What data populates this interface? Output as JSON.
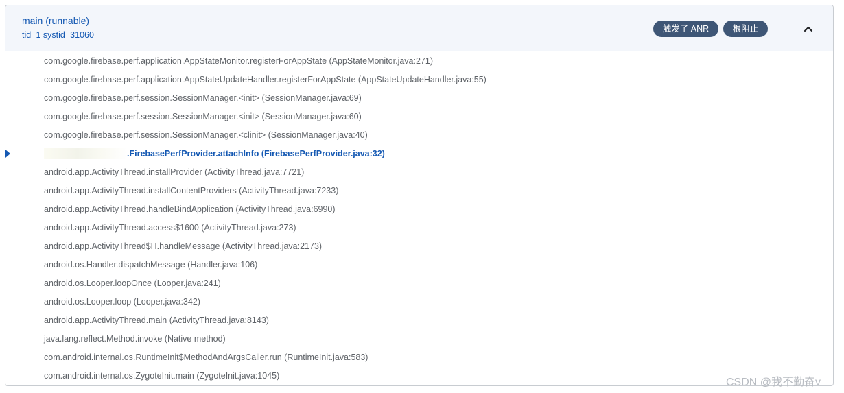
{
  "thread": {
    "title": "main (runnable)",
    "ids": "tid=1 systid=31060",
    "badges": {
      "anr": "触发了 ANR",
      "blocking": "根阻止"
    },
    "collapse_icon": "chevron-up-icon"
  },
  "stack_frames": [
    {
      "text": "com.google.firebase.perf.application.AppStateMonitor.registerForAppState (AppStateMonitor.java:271)"
    },
    {
      "text": "com.google.firebase.perf.application.AppStateUpdateHandler.registerForAppState (AppStateUpdateHandler.java:55)"
    },
    {
      "text": "com.google.firebase.perf.session.SessionManager.<init> (SessionManager.java:69)"
    },
    {
      "text": "com.google.firebase.perf.session.SessionManager.<init> (SessionManager.java:60)"
    },
    {
      "text": "com.google.firebase.perf.session.SessionManager.<clinit> (SessionManager.java:40)"
    },
    {
      "text": ".FirebasePerfProvider.attachInfo (FirebasePerfProvider.java:32)"
    },
    {
      "text": "android.app.ActivityThread.installProvider (ActivityThread.java:7721)"
    },
    {
      "text": "android.app.ActivityThread.installContentProviders (ActivityThread.java:7233)"
    },
    {
      "text": "android.app.ActivityThread.handleBindApplication (ActivityThread.java:6990)"
    },
    {
      "text": "android.app.ActivityThread.access$1600 (ActivityThread.java:273)"
    },
    {
      "text": "android.app.ActivityThread$H.handleMessage (ActivityThread.java:2173)"
    },
    {
      "text": "android.os.Handler.dispatchMessage (Handler.java:106)"
    },
    {
      "text": "android.os.Looper.loopOnce (Looper.java:241)"
    },
    {
      "text": "android.os.Looper.loop (Looper.java:342)"
    },
    {
      "text": "android.app.ActivityThread.main (ActivityThread.java:8143)"
    },
    {
      "text": "java.lang.reflect.Method.invoke (Native method)"
    },
    {
      "text": "com.android.internal.os.RuntimeInit$MethodAndArgsCaller.run (RuntimeInit.java:583)"
    },
    {
      "text": "com.android.internal.os.ZygoteInit.main (ZygoteInit.java:1045)"
    }
  ],
  "watermark": "CSDN @我不勤奋v",
  "colors": {
    "accent": "#1559b3",
    "badge": "#3e5676",
    "header_bg": "#f3f6fb",
    "frame_text": "#5f6368"
  }
}
